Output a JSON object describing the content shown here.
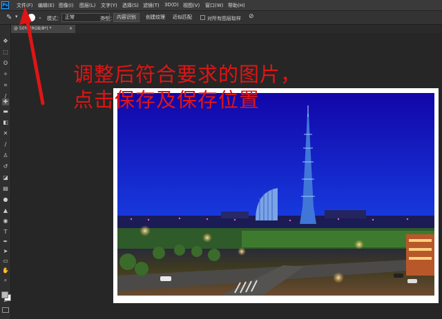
{
  "app": {
    "logo": "Ps"
  },
  "menu": [
    "文件(F)",
    "编辑(E)",
    "图像(I)",
    "图层(L)",
    "文字(Y)",
    "选择(S)",
    "滤镜(T)",
    "3D(D)",
    "视图(V)",
    "窗口(W)",
    "帮助(H)"
  ],
  "options": {
    "brush_size": "5",
    "mode_label": "模式：",
    "mode_value": "正常",
    "type_label": "类型：",
    "type_buttons": [
      "内容识别",
      "创建纹理",
      "近似匹配"
    ],
    "sample_all_label": "对所有图层取样"
  },
  "tab": {
    "title": "@ 50% (RGB/8*) *",
    "close": "×"
  },
  "annotation": {
    "line1": "调整后符合要求的图片，",
    "line2": "点击保存及保存位置",
    "color": "#e01515"
  },
  "toolbar_icons": [
    "move-tool-icon",
    "marquee-tool-icon",
    "lasso-tool-icon",
    "magic-wand-icon",
    "crop-tool-icon",
    "eyedropper-icon",
    "spot-healing-brush-icon",
    "brush-tool-icon",
    "clone-stamp-icon",
    "history-brush-icon",
    "eraser-icon",
    "gradient-icon",
    "blur-icon",
    "dodge-icon",
    "pen-tool-icon",
    "type-tool-icon",
    "path-select-icon",
    "shape-tool-icon",
    "hand-tool-icon",
    "zoom-tool-icon",
    "more-tools-icon"
  ]
}
